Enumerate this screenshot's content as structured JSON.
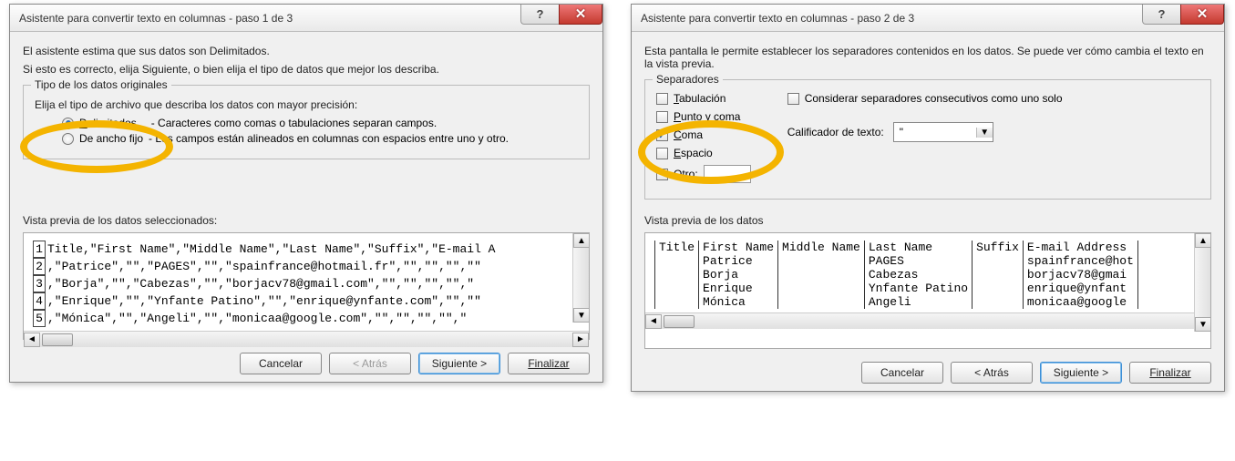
{
  "dialog1": {
    "title": "Asistente para convertir texto en columnas - paso 1 de 3",
    "intro1": "El asistente estima que sus datos son Delimitados.",
    "intro2": "Si esto es correcto, elija Siguiente, o bien elija el tipo de datos que mejor los describa.",
    "group_title": "Tipo de los datos originales",
    "subtitle": "Elija el tipo de archivo que describa los datos con mayor precisión:",
    "radio_delim_prefix": "D",
    "radio_delim_rest": "elimitados",
    "radio_delim_desc": " - Caracteres como comas o tabulaciones separan campos.",
    "radio_fixed": "De ancho fijo",
    "radio_fixed_desc": " - Los campos están alineados en columnas con espacios entre uno y otro.",
    "preview_label": "Vista previa de los datos seleccionados:",
    "rows": [
      "Title,\"First Name\",\"Middle Name\",\"Last Name\",\"Suffix\",\"E-mail A",
      ",\"Patrice\",\"\",\"PAGES\",\"\",\"spainfrance@hotmail.fr\",\"\",\"\",\"\",\"\"",
      ",\"Borja\",\"\",\"Cabezas\",\"\",\"borjacv78@gmail.com\",\"\",\"\",\"\",\"\",\"",
      ",\"Enrique\",\"\",\"Ynfante Patino\",\"\",\"enrique@ynfante.com\",\"\",\"\"",
      ",\"Mónica\",\"\",\"Angeli\",\"\",\"monicaa@google.com\",\"\",\"\",\"\",\"\",\""
    ],
    "btn_cancel": "Cancelar",
    "btn_back": "< Atrás",
    "btn_next": "Siguiente >",
    "btn_finish": "Finalizar",
    "btn_help": "?",
    "btn_close": "✕"
  },
  "dialog2": {
    "title": "Asistente para convertir texto en columnas - paso 2 de 3",
    "intro": "Esta pantalla le permite establecer los separadores contenidos en los datos. Se puede ver cómo cambia el texto en la vista previa.",
    "group_title": "Separadores",
    "chk_tab_u": "T",
    "chk_tab": "abulación",
    "chk_semi_u": "P",
    "chk_semi": "unto y coma",
    "chk_comma_u": "C",
    "chk_comma": "oma",
    "chk_space_u": "E",
    "chk_space": "spacio",
    "chk_other_u": "O",
    "chk_other": "tro:",
    "chk_consec": "Considerar separadores consecutivos como uno solo",
    "qual_label": "Calificador de texto:",
    "qual_value": "\"",
    "preview_label": "Vista previa de los datos",
    "headers": [
      "Title",
      "First Name",
      "Middle Name",
      "Last Name",
      "Suffix",
      "E-mail Address"
    ],
    "rows": [
      [
        "",
        "Patrice",
        "",
        "PAGES",
        "",
        "spainfrance@hot"
      ],
      [
        "",
        "Borja",
        "",
        "Cabezas",
        "",
        "borjacv78@gmai"
      ],
      [
        "",
        "Enrique",
        "",
        "Ynfante Patino",
        "",
        "enrique@ynfant"
      ],
      [
        "",
        "Mónica",
        "",
        "Angeli",
        "",
        "monicaa@google"
      ]
    ],
    "btn_cancel": "Cancelar",
    "btn_back": "< Atrás",
    "btn_next": "Siguiente >",
    "btn_finish": "Finalizar",
    "btn_help": "?",
    "btn_close": "✕"
  }
}
